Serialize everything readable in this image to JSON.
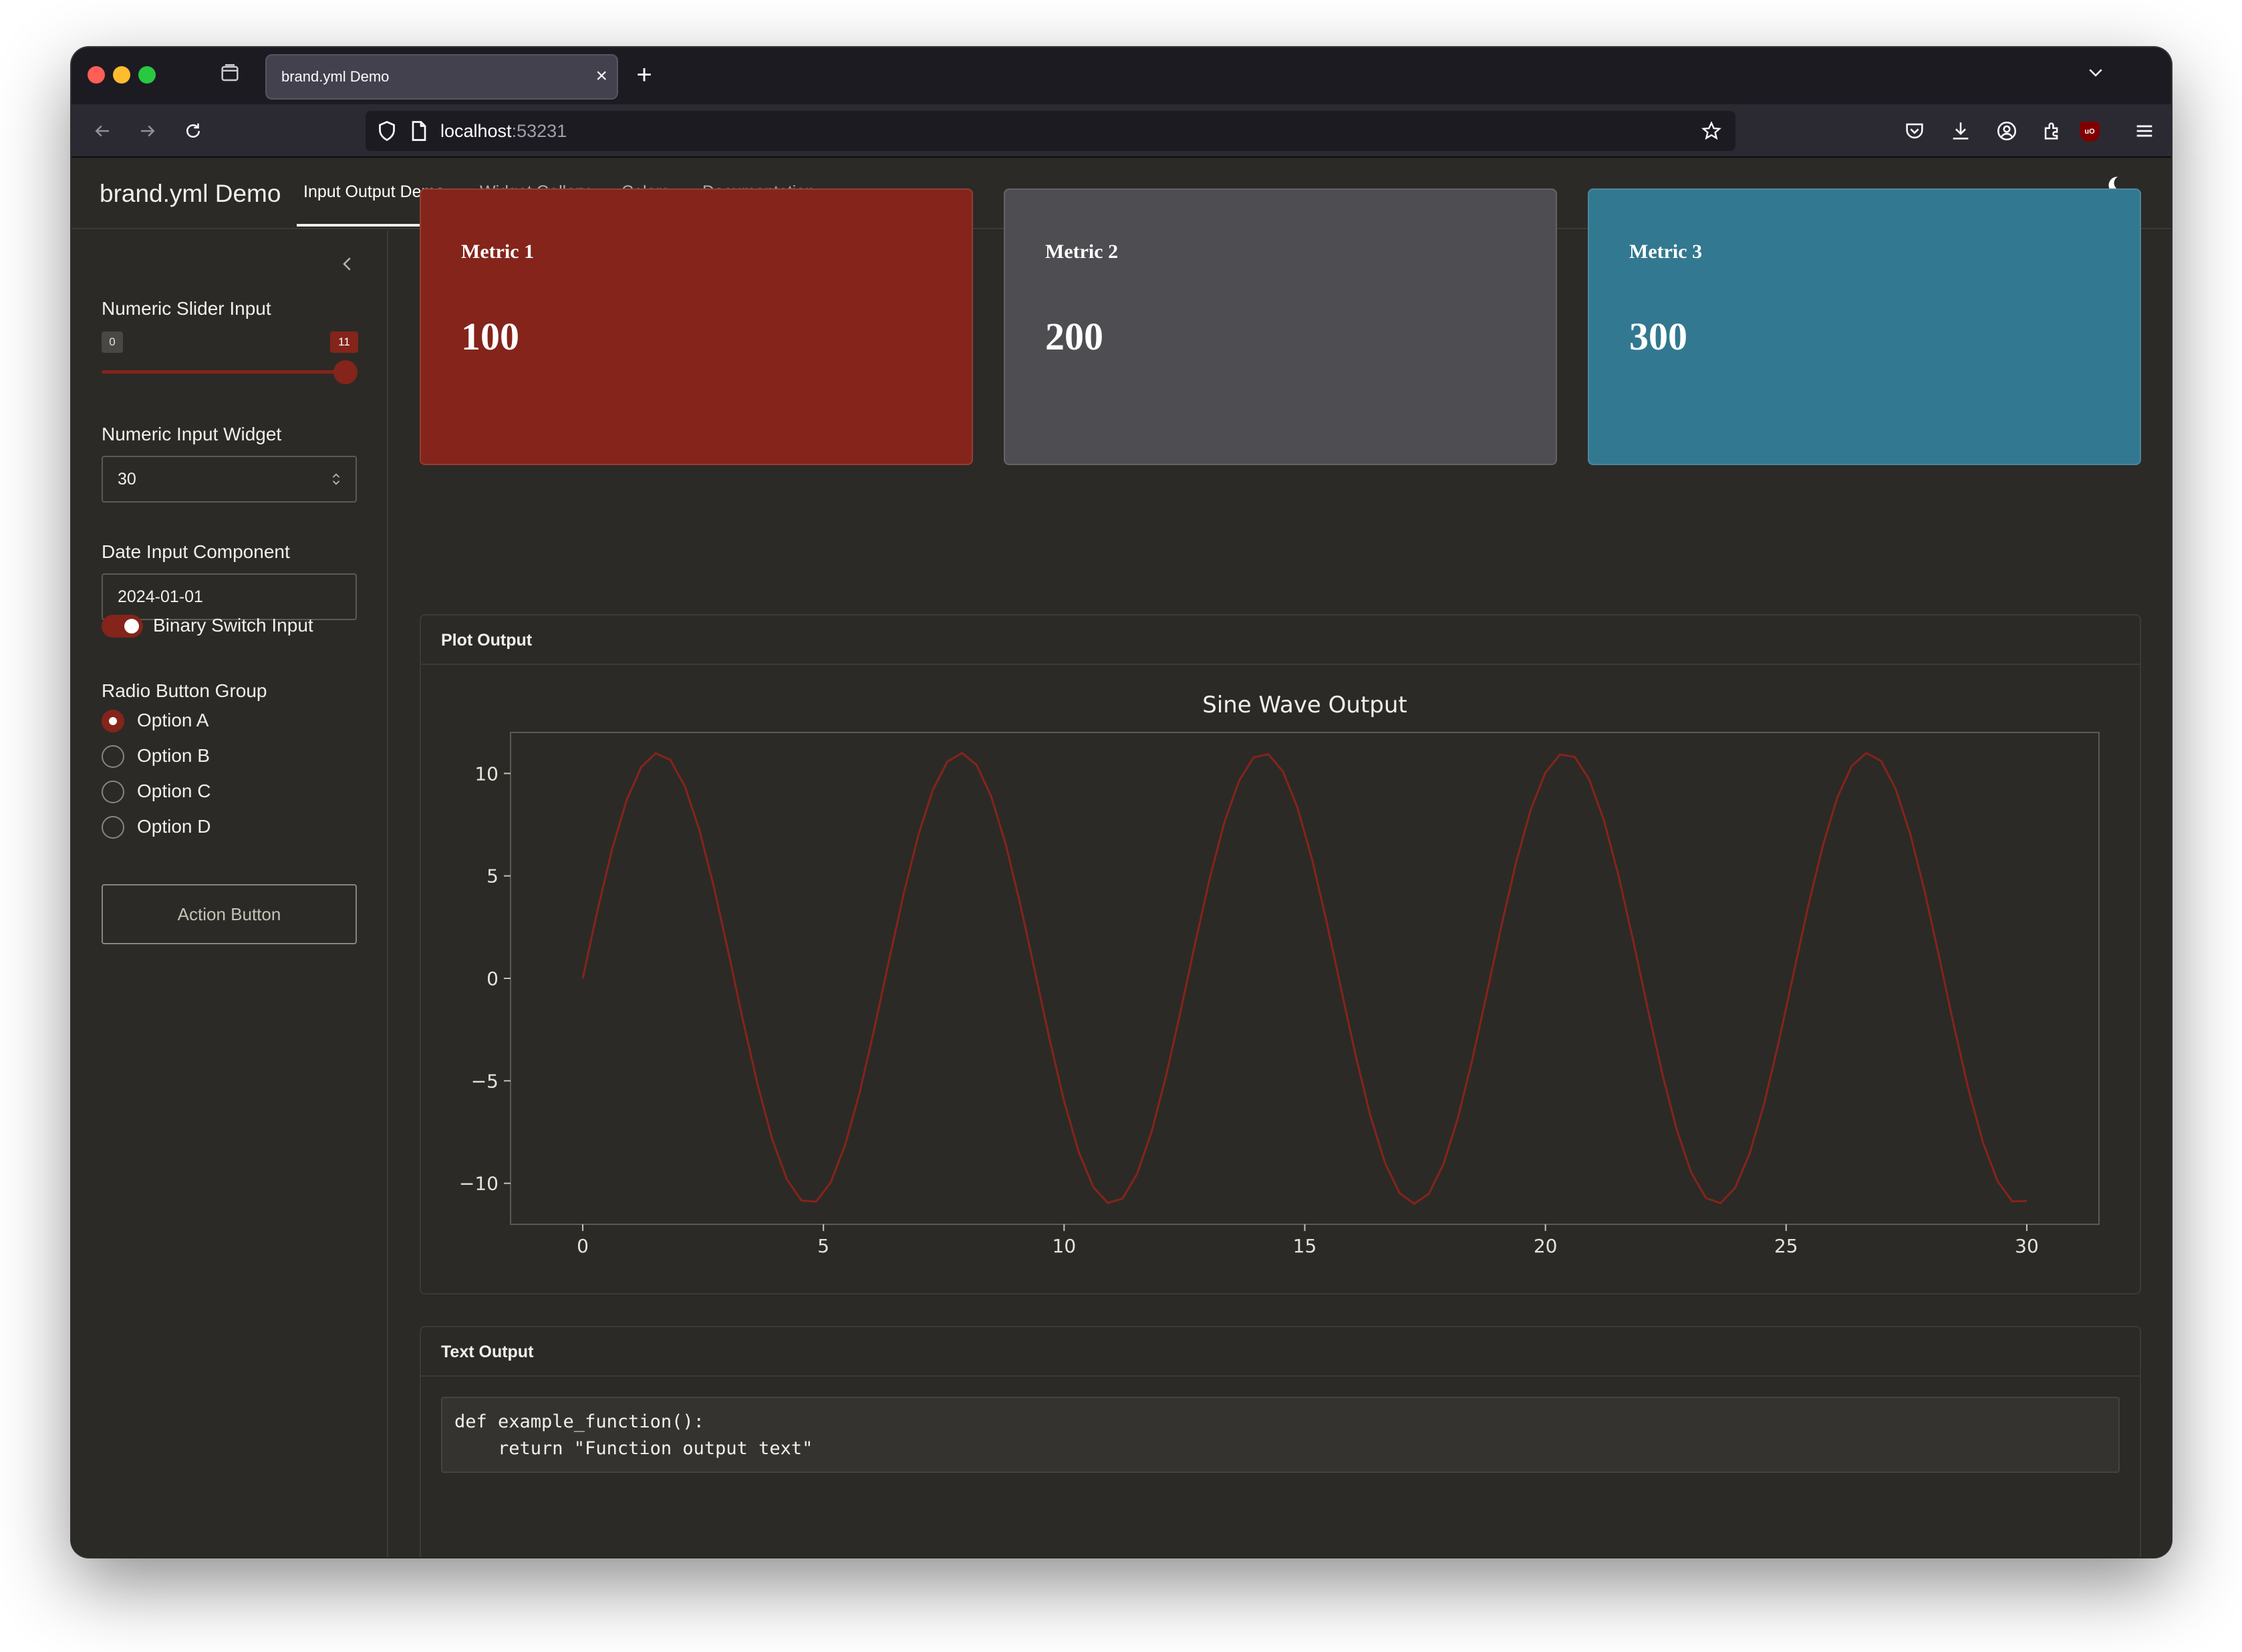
{
  "browser": {
    "tab_title": "brand.yml Demo",
    "tab_close": "×",
    "new_tab": "+",
    "url_host": "localhost",
    "url_port": ":53231"
  },
  "app": {
    "brand": "brand.yml Demo",
    "nav": [
      "Input Output Demo",
      "Widget Gallery",
      "Colors",
      "Documentation"
    ],
    "active_nav": "Input Output Demo"
  },
  "sidebar": {
    "slider_label": "Numeric Slider Input",
    "slider_min": "0",
    "slider_value": "11",
    "slider_fraction": 1.0,
    "numeric_label": "Numeric Input Widget",
    "numeric_value": "30",
    "date_label": "Date Input Component",
    "date_value": "2024-01-01",
    "switch_label": "Binary Switch Input",
    "switch_on": true,
    "radio_label": "Radio Button Group",
    "radio_options": [
      "Option A",
      "Option B",
      "Option C",
      "Option D"
    ],
    "radio_selected": "Option A",
    "action_button": "Action Button"
  },
  "metrics": [
    {
      "title": "Metric 1",
      "value": "100",
      "color": "#84241b"
    },
    {
      "title": "Metric 2",
      "value": "200",
      "color": "#4e4e52"
    },
    {
      "title": "Metric 3",
      "value": "300",
      "color": "#327890"
    }
  ],
  "plot_card": {
    "title": "Plot Output"
  },
  "text_card": {
    "title": "Text Output",
    "code_line1": "def example_function():",
    "code_line2": "    return \"Function output text\""
  },
  "colors": {
    "primary": "#84241b",
    "background": "#2c2a26",
    "metric_gray": "#4e4e52",
    "metric_teal": "#327890"
  },
  "chart_data": {
    "type": "line",
    "title": "Sine Wave Output",
    "xlabel": "",
    "ylabel": "",
    "x_ticks": [
      0,
      5,
      10,
      15,
      20,
      25,
      30
    ],
    "y_ticks": [
      10,
      5,
      0,
      -5,
      -10
    ],
    "y_tick_labels": [
      "10",
      "5",
      "0",
      "−5",
      "−10"
    ],
    "xlim": [
      -1.5,
      31.5
    ],
    "ylim": [
      -12,
      12
    ],
    "function": "y = 11 * sin(x)",
    "amplitude": 11,
    "x_range": [
      0,
      30
    ],
    "points": 100,
    "line_color": "#84241b",
    "grid": false
  }
}
